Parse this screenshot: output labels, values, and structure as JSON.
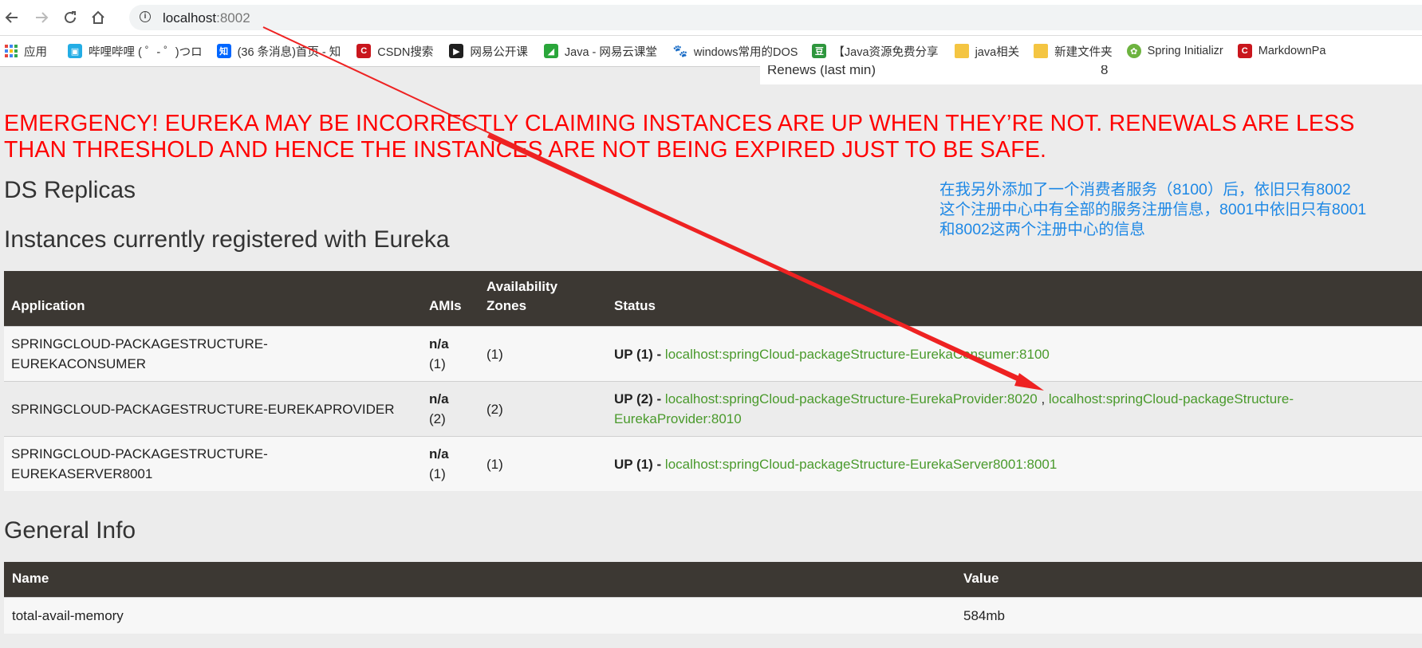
{
  "browser": {
    "url_host": "localhost",
    "url_port": ":8002",
    "bookmarks": [
      {
        "label": "应用",
        "icon": "apps-grid-icon"
      },
      {
        "label": "哔哩哔哩 ( ゜- ゜)つロ",
        "icon": "bilibili-icon"
      },
      {
        "label": "(36 条消息)首页 - 知",
        "icon": "zhihu-icon"
      },
      {
        "label": "CSDN搜索",
        "icon": "csdn-icon"
      },
      {
        "label": "网易公开课",
        "icon": "netease-open-course-icon"
      },
      {
        "label": "Java - 网易云课堂",
        "icon": "netease-cloud-class-icon"
      },
      {
        "label": "windows常用的DOS",
        "icon": "baidu-paw-icon"
      },
      {
        "label": "【Java资源免费分享",
        "icon": "douban-icon"
      },
      {
        "label": "java相关",
        "icon": "folder-icon"
      },
      {
        "label": "新建文件夹",
        "icon": "folder-icon"
      },
      {
        "label": "Spring Initializr",
        "icon": "spring-icon"
      },
      {
        "label": "MarkdownPa",
        "icon": "markdownpad-icon"
      }
    ]
  },
  "renews_row": {
    "label": "Renews (last min)",
    "value": "8"
  },
  "emergency": {
    "line1": "EMERGENCY! EUREKA MAY BE INCORRECTLY CLAIMING INSTANCES ARE UP WHEN THEY’RE NOT. RENEWALS ARE LESS",
    "line2": "THAN THRESHOLD AND HENCE THE INSTANCES ARE NOT BEING EXPIRED JUST TO BE SAFE."
  },
  "headings": {
    "ds_replicas": "DS Replicas",
    "instances": "Instances currently registered with Eureka",
    "general_info": "General Info"
  },
  "annotation": {
    "line1": "在我另外添加了一个消费者服务（8100）后，依旧只有8002",
    "line2": "这个注册中心中有全部的服务注册信息，8001中依旧只有8001",
    "line3": "和8002这两个注册中心的信息"
  },
  "instances_table": {
    "headers": {
      "application": "Application",
      "amis": "AMIs",
      "zones_line1": "Availability",
      "zones_line2": "Zones",
      "status": "Status"
    },
    "rows": [
      {
        "app_line1": "SPRINGCLOUD-PACKAGESTRUCTURE-",
        "app_line2": "EUREKACONSUMER",
        "amis_line1": "n/a",
        "amis_line2": "(1)",
        "zones": "(1)",
        "status_prefix": "UP (1) - ",
        "link1": "localhost:springCloud-packageStructure-EurekaConsumer:8100",
        "link2": ""
      },
      {
        "app_line1": "SPRINGCLOUD-PACKAGESTRUCTURE-EUREKAPROVIDER",
        "app_line2": "",
        "amis_line1": "n/a",
        "amis_line2": "(2)",
        "zones": "(2)",
        "status_prefix": "UP (2) - ",
        "link1": "localhost:springCloud-packageStructure-EurekaProvider:8020",
        "link2": "localhost:springCloud-packageStructure-EurekaProvider:8010"
      },
      {
        "app_line1": "SPRINGCLOUD-PACKAGESTRUCTURE-",
        "app_line2": "EUREKASERVER8001",
        "amis_line1": "n/a",
        "amis_line2": "(1)",
        "zones": "(1)",
        "status_prefix": "UP (1) - ",
        "link1": "localhost:springCloud-packageStructure-EurekaServer8001:8001",
        "link2": ""
      }
    ]
  },
  "general_table": {
    "headers": {
      "name": "Name",
      "value": "Value"
    },
    "rows": [
      {
        "name": "total-avail-memory",
        "value": "584mb"
      }
    ]
  },
  "colors": {
    "emergency": "#ff0000",
    "annotation": "#1e88e5",
    "arrow": "#ee2222",
    "link": "#4a9a2c",
    "table_header": "#3c3833"
  }
}
